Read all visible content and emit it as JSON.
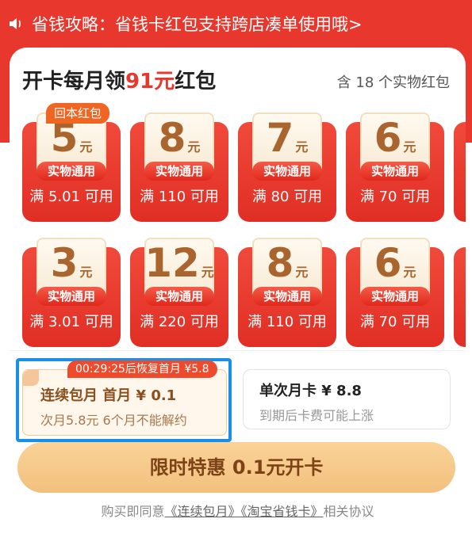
{
  "notice": {
    "text": "省钱攻略：省钱卡红包支持跨店凑单使用哦>"
  },
  "header": {
    "title_prefix": "开卡每月领",
    "title_amount": "91元",
    "title_suffix": "红包",
    "count_text": "含 18 个实物红包"
  },
  "badge_text": "回本红包",
  "envelopes": [
    {
      "value": "5",
      "unit": "元",
      "tag": "实物通用",
      "cond": "满 5.01 可用"
    },
    {
      "value": "8",
      "unit": "元",
      "tag": "实物通用",
      "cond": "满 110 可用"
    },
    {
      "value": "7",
      "unit": "元",
      "tag": "实物通用",
      "cond": "满 80 可用"
    },
    {
      "value": "6",
      "unit": "元",
      "tag": "实物通用",
      "cond": "满 70 可用"
    },
    {
      "value": "3",
      "unit": "元",
      "tag": "实物通用",
      "cond": "满 3.01 可用"
    },
    {
      "value": "12",
      "unit": "元",
      "tag": "实物通用",
      "cond": "满 220 可用"
    },
    {
      "value": "8",
      "unit": "元",
      "tag": "实物通用",
      "cond": "满 110 可用"
    },
    {
      "value": "6",
      "unit": "元",
      "tag": "实物通用",
      "cond": "满 70 可用"
    }
  ],
  "plans": {
    "monthly": {
      "timer": "00:29:25后恢复首月 ¥5.8",
      "title": "连续包月 首月 ¥ 0.1",
      "sub": "次月5.8元 6个月不能解约"
    },
    "single": {
      "title": "单次月卡 ¥ 8.8",
      "sub": "到期后卡费可能上涨"
    }
  },
  "cta": {
    "label": "限时特惠 0.1元开卡"
  },
  "agreement": {
    "prefix": "购买即同意",
    "link1": "《连续包月》",
    "link2": "《淘宝省钱卡》",
    "suffix": "相关协议"
  },
  "colors": {
    "brand_red": "#e8372c",
    "selected_border": "#1a8fe8",
    "cta_bg": "#f2c07e"
  }
}
